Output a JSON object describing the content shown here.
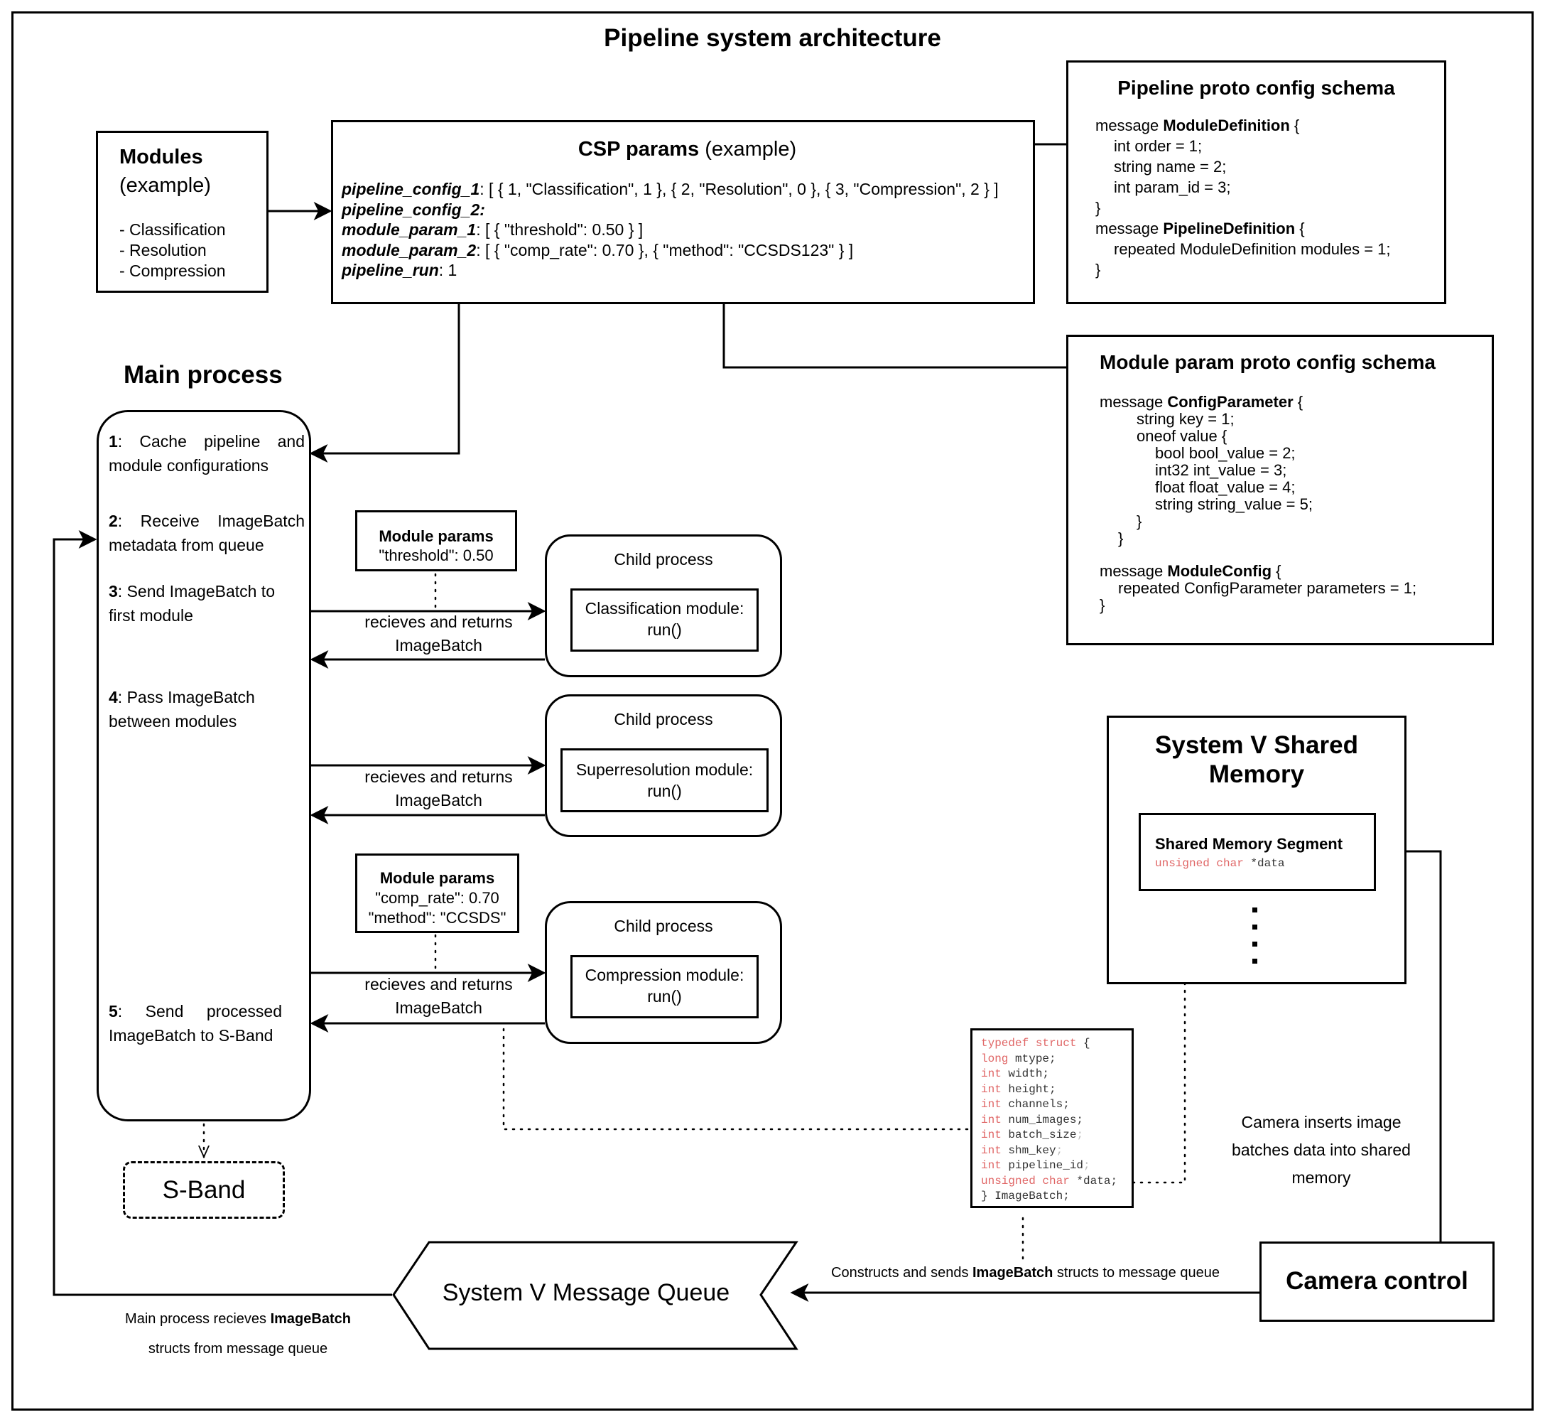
{
  "title": "Pipeline system architecture",
  "modules_box": {
    "heading": "Modules",
    "subheading": "(example)",
    "items": [
      "- Classification",
      "- Resolution",
      "- Compression"
    ]
  },
  "csp_params": {
    "heading_bold": "CSP params",
    "heading_rest": " (example)",
    "lines": [
      {
        "key": "pipeline_config_1",
        "value": ": [ { 1, \"Classification\", 1 }, { 2, \"Resolution\", 0 }, { 3, \"Compression\", 2 } ]"
      },
      {
        "key": "pipeline_config_2:",
        "value": ""
      },
      {
        "key": "module_param_1",
        "value": ": [ { \"threshold\": 0.50 } ]"
      },
      {
        "key": "module_param_2",
        "value": ": [ { \"comp_rate\": 0.70 }, { \"method\": \"CCSDS123\" } ]"
      },
      {
        "key": "pipeline_run",
        "value": ": 1"
      }
    ]
  },
  "pipeline_schema": {
    "heading": "Pipeline proto config schema",
    "lines": [
      {
        "pre": "message ",
        "bold": "ModuleDefinition",
        "post": " {",
        "indent": 0
      },
      {
        "pre": "int order = 1;",
        "bold": "",
        "post": "",
        "indent": 1
      },
      {
        "pre": "string name = 2;",
        "bold": "",
        "post": "",
        "indent": 1
      },
      {
        "pre": "int param_id = 3;",
        "bold": "",
        "post": "",
        "indent": 1
      },
      {
        "pre": "}",
        "bold": "",
        "post": "",
        "indent": 0
      },
      {
        "pre": "message ",
        "bold": "PipelineDefinition",
        "post": " {",
        "indent": 0
      },
      {
        "pre": "repeated ModuleDefinition modules = 1;",
        "bold": "",
        "post": "",
        "indent": 1
      },
      {
        "pre": "}",
        "bold": "",
        "post": "",
        "indent": 0
      }
    ]
  },
  "module_param_schema": {
    "heading": "Module param proto config schema",
    "lines": [
      {
        "pre": "message ",
        "bold": "ConfigParameter",
        "post": " {",
        "indent": 0
      },
      {
        "pre": "string key = 1;",
        "bold": "",
        "post": "",
        "indent": 2
      },
      {
        "pre": "oneof value {",
        "bold": "",
        "post": "",
        "indent": 2
      },
      {
        "pre": "bool bool_value = 2;",
        "bold": "",
        "post": "",
        "indent": 3
      },
      {
        "pre": "int32 int_value = 3;",
        "bold": "",
        "post": "",
        "indent": 3
      },
      {
        "pre": "float float_value = 4;",
        "bold": "",
        "post": "",
        "indent": 3
      },
      {
        "pre": "string string_value = 5;",
        "bold": "",
        "post": "",
        "indent": 3
      },
      {
        "pre": "}",
        "bold": "",
        "post": "",
        "indent": 2
      },
      {
        "pre": "}",
        "bold": "",
        "post": "",
        "indent": 1
      },
      {
        "pre": "",
        "bold": "",
        "post": "",
        "indent": 0
      },
      {
        "pre": "message ",
        "bold": "ModuleConfig",
        "post": " {",
        "indent": 0
      },
      {
        "pre": "repeated ConfigParameter parameters = 1;",
        "bold": "",
        "post": "",
        "indent": 1
      },
      {
        "pre": "}",
        "bold": "",
        "post": "",
        "indent": 0
      }
    ]
  },
  "main_process": {
    "heading": "Main process",
    "steps": [
      {
        "num": "1",
        "text": ": Cache pipeline and module configurations"
      },
      {
        "num": "2",
        "text": ": Receive ImageBatch metadata from queue"
      },
      {
        "num": "3",
        "text": ": Send ImageBatch to first module"
      },
      {
        "num": "4",
        "text": ": Pass ImageBatch between modules"
      },
      {
        "num": "5",
        "text": ": Send processed ImageBatch to S-Band"
      }
    ]
  },
  "module_params_1": {
    "heading": "Module params",
    "lines": [
      "\"threshold\": 0.50"
    ]
  },
  "module_params_2": {
    "heading": "Module params",
    "lines": [
      "\"comp_rate\": 0.70",
      "\"method\": \"CCSDS\""
    ]
  },
  "child_processes": [
    {
      "label": "Child process",
      "module": "Classification module:",
      "call": "run()"
    },
    {
      "label": "Child process",
      "module": "Superresolution module:",
      "call": "run()"
    },
    {
      "label": "Child process",
      "module": "Compression module:",
      "call": "run()"
    }
  ],
  "edge_label": {
    "line1": "recieves and returns",
    "line2": "ImageBatch"
  },
  "s_band": "S-Band",
  "shared_memory": {
    "heading_line1": "System V Shared",
    "heading_line2": "Memory",
    "segment_title": "Shared Memory Segment",
    "segment_kw": "unsigned char",
    "segment_var": " *data"
  },
  "struct_code": {
    "lines": [
      {
        "kw": "typedef struct",
        "rest": " {",
        "tail": ""
      },
      {
        "kw": "long",
        "rest": " mtype;",
        "tail": ""
      },
      {
        "kw": "int",
        "rest": " width;",
        "tail": ""
      },
      {
        "kw": "int",
        "rest": " height;",
        "tail": ""
      },
      {
        "kw": "int",
        "rest": " channels;",
        "tail": ""
      },
      {
        "kw": "int",
        "rest": " num_images;",
        "tail": ""
      },
      {
        "kw": "int",
        "rest": " batch_size",
        "tail": ";"
      },
      {
        "kw": "int",
        "rest": " shm_key",
        "tail": ";"
      },
      {
        "kw": "int",
        "rest": " pipeline_id",
        "tail": ";"
      },
      {
        "kw": "unsigned char",
        "rest": " *data;",
        "tail": ""
      },
      {
        "kw": "",
        "rest": "} ImageBatch;",
        "tail": ""
      }
    ]
  },
  "camera_note": {
    "lines": [
      "Camera inserts image",
      "batches data into shared",
      "memory"
    ]
  },
  "camera_control": "Camera control",
  "message_queue": "System V Message Queue",
  "send_label": {
    "pre": "Constructs and sends ",
    "bold": "ImageBatch",
    "post": " structs to message queue"
  },
  "receive_label": {
    "pre": "Main process recieves ",
    "bold": "ImageBatch",
    "line2": "structs from message queue"
  },
  "colors": {
    "keyword": "#e06666",
    "line": "#000000",
    "dim": "#bbbbbb"
  }
}
